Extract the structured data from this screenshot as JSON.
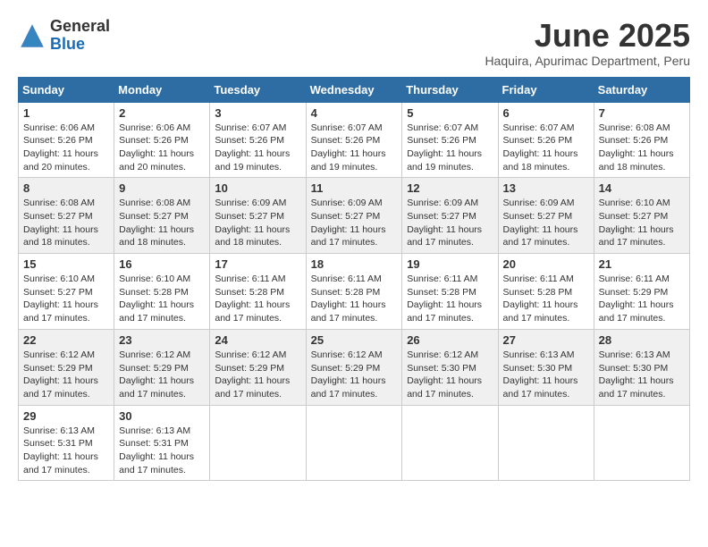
{
  "logo": {
    "general": "General",
    "blue": "Blue"
  },
  "header": {
    "month": "June 2025",
    "location": "Haquira, Apurimac Department, Peru"
  },
  "weekdays": [
    "Sunday",
    "Monday",
    "Tuesday",
    "Wednesday",
    "Thursday",
    "Friday",
    "Saturday"
  ],
  "weeks": [
    [
      {
        "day": "1",
        "info": "Sunrise: 6:06 AM\nSunset: 5:26 PM\nDaylight: 11 hours\nand 20 minutes."
      },
      {
        "day": "2",
        "info": "Sunrise: 6:06 AM\nSunset: 5:26 PM\nDaylight: 11 hours\nand 20 minutes."
      },
      {
        "day": "3",
        "info": "Sunrise: 6:07 AM\nSunset: 5:26 PM\nDaylight: 11 hours\nand 19 minutes."
      },
      {
        "day": "4",
        "info": "Sunrise: 6:07 AM\nSunset: 5:26 PM\nDaylight: 11 hours\nand 19 minutes."
      },
      {
        "day": "5",
        "info": "Sunrise: 6:07 AM\nSunset: 5:26 PM\nDaylight: 11 hours\nand 19 minutes."
      },
      {
        "day": "6",
        "info": "Sunrise: 6:07 AM\nSunset: 5:26 PM\nDaylight: 11 hours\nand 18 minutes."
      },
      {
        "day": "7",
        "info": "Sunrise: 6:08 AM\nSunset: 5:26 PM\nDaylight: 11 hours\nand 18 minutes."
      }
    ],
    [
      {
        "day": "8",
        "info": "Sunrise: 6:08 AM\nSunset: 5:27 PM\nDaylight: 11 hours\nand 18 minutes."
      },
      {
        "day": "9",
        "info": "Sunrise: 6:08 AM\nSunset: 5:27 PM\nDaylight: 11 hours\nand 18 minutes."
      },
      {
        "day": "10",
        "info": "Sunrise: 6:09 AM\nSunset: 5:27 PM\nDaylight: 11 hours\nand 18 minutes."
      },
      {
        "day": "11",
        "info": "Sunrise: 6:09 AM\nSunset: 5:27 PM\nDaylight: 11 hours\nand 17 minutes."
      },
      {
        "day": "12",
        "info": "Sunrise: 6:09 AM\nSunset: 5:27 PM\nDaylight: 11 hours\nand 17 minutes."
      },
      {
        "day": "13",
        "info": "Sunrise: 6:09 AM\nSunset: 5:27 PM\nDaylight: 11 hours\nand 17 minutes."
      },
      {
        "day": "14",
        "info": "Sunrise: 6:10 AM\nSunset: 5:27 PM\nDaylight: 11 hours\nand 17 minutes."
      }
    ],
    [
      {
        "day": "15",
        "info": "Sunrise: 6:10 AM\nSunset: 5:27 PM\nDaylight: 11 hours\nand 17 minutes."
      },
      {
        "day": "16",
        "info": "Sunrise: 6:10 AM\nSunset: 5:28 PM\nDaylight: 11 hours\nand 17 minutes."
      },
      {
        "day": "17",
        "info": "Sunrise: 6:11 AM\nSunset: 5:28 PM\nDaylight: 11 hours\nand 17 minutes."
      },
      {
        "day": "18",
        "info": "Sunrise: 6:11 AM\nSunset: 5:28 PM\nDaylight: 11 hours\nand 17 minutes."
      },
      {
        "day": "19",
        "info": "Sunrise: 6:11 AM\nSunset: 5:28 PM\nDaylight: 11 hours\nand 17 minutes."
      },
      {
        "day": "20",
        "info": "Sunrise: 6:11 AM\nSunset: 5:28 PM\nDaylight: 11 hours\nand 17 minutes."
      },
      {
        "day": "21",
        "info": "Sunrise: 6:11 AM\nSunset: 5:29 PM\nDaylight: 11 hours\nand 17 minutes."
      }
    ],
    [
      {
        "day": "22",
        "info": "Sunrise: 6:12 AM\nSunset: 5:29 PM\nDaylight: 11 hours\nand 17 minutes."
      },
      {
        "day": "23",
        "info": "Sunrise: 6:12 AM\nSunset: 5:29 PM\nDaylight: 11 hours\nand 17 minutes."
      },
      {
        "day": "24",
        "info": "Sunrise: 6:12 AM\nSunset: 5:29 PM\nDaylight: 11 hours\nand 17 minutes."
      },
      {
        "day": "25",
        "info": "Sunrise: 6:12 AM\nSunset: 5:29 PM\nDaylight: 11 hours\nand 17 minutes."
      },
      {
        "day": "26",
        "info": "Sunrise: 6:12 AM\nSunset: 5:30 PM\nDaylight: 11 hours\nand 17 minutes."
      },
      {
        "day": "27",
        "info": "Sunrise: 6:13 AM\nSunset: 5:30 PM\nDaylight: 11 hours\nand 17 minutes."
      },
      {
        "day": "28",
        "info": "Sunrise: 6:13 AM\nSunset: 5:30 PM\nDaylight: 11 hours\nand 17 minutes."
      }
    ],
    [
      {
        "day": "29",
        "info": "Sunrise: 6:13 AM\nSunset: 5:31 PM\nDaylight: 11 hours\nand 17 minutes."
      },
      {
        "day": "30",
        "info": "Sunrise: 6:13 AM\nSunset: 5:31 PM\nDaylight: 11 hours\nand 17 minutes."
      },
      {
        "day": "",
        "info": ""
      },
      {
        "day": "",
        "info": ""
      },
      {
        "day": "",
        "info": ""
      },
      {
        "day": "",
        "info": ""
      },
      {
        "day": "",
        "info": ""
      }
    ]
  ]
}
